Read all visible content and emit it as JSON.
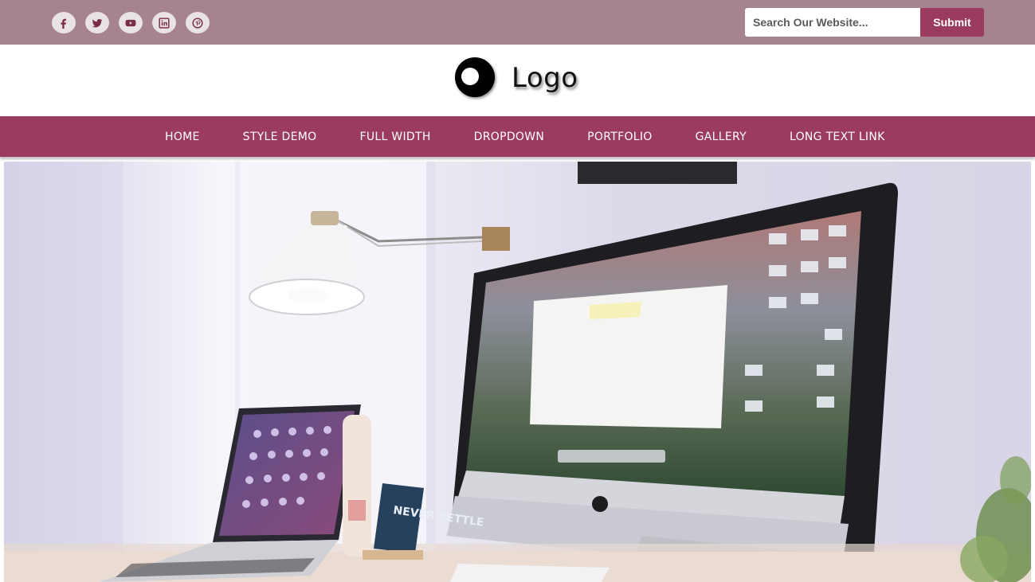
{
  "topbar": {
    "social": [
      {
        "name": "facebook-icon"
      },
      {
        "name": "twitter-icon"
      },
      {
        "name": "youtube-icon"
      },
      {
        "name": "linkedin-icon"
      },
      {
        "name": "pinterest-icon"
      }
    ],
    "search": {
      "placeholder": "Search Our Website...",
      "value": "",
      "submit_label": "Submit"
    }
  },
  "logo": {
    "text": "Logo"
  },
  "nav": {
    "items": [
      {
        "label": "HOME"
      },
      {
        "label": "STYLE DEMO"
      },
      {
        "label": "FULL WIDTH"
      },
      {
        "label": "DROPDOWN"
      },
      {
        "label": "PORTFOLIO"
      },
      {
        "label": "GALLERY"
      },
      {
        "label": "LONG TEXT LINK"
      }
    ]
  },
  "hero": {
    "card_text": "NEVER SETTLE"
  },
  "colors": {
    "topbar_bg": "#a6848f",
    "accent": "#9b3b5f",
    "icon_bg": "#e9e3e5",
    "icon_fg": "#7a2e4a"
  }
}
